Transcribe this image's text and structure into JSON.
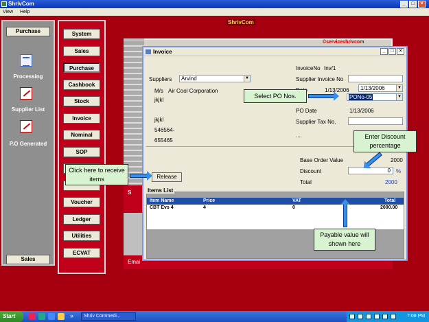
{
  "window": {
    "title": "ShrivCom",
    "buttons": [
      "_",
      "□",
      "×"
    ]
  },
  "menu": [
    "View",
    "Help"
  ],
  "brand": "ShrivCom",
  "sidebar": {
    "top_button": "Purchase",
    "items": [
      {
        "label": "Processing",
        "icon": "document-icon"
      },
      {
        "label": "Supplier List",
        "icon": "edit-icon"
      },
      {
        "label": "P.O Generated",
        "icon": "edit-icon"
      }
    ],
    "bottom_button": "Sales"
  },
  "modules": [
    "System",
    "Sales",
    "Purchase",
    "Cashbook",
    "Stock",
    "Invoice",
    "Nominal",
    "SOP",
    "",
    "",
    "Voucher",
    "Ledger",
    "Utilities",
    "ECVAT"
  ],
  "active_module": "Purchase",
  "background": {
    "logo": "©serviceshrivcom",
    "footer_text": "Emai",
    "red_bar_text": "S"
  },
  "invoice": {
    "title": "Invoice",
    "suppliers_label": "Suppliers",
    "suppliers_value": "Arvind",
    "ms_label": "M/s",
    "ms_value": "Air  Cool Corporation",
    "address": [
      "jkjkl",
      "jkjkl",
      "546564-",
      "655465"
    ],
    "invoice_no_label": "InvoiceNo",
    "invoice_no_value": "Inv/1",
    "supplier_invoice_no_label": "Supplier Invoice No",
    "date_label": "Date",
    "date_value": "1/13/2006",
    "date_picker_value": "1/13/2006",
    "po_nos_value": "PONo-05",
    "po_date_label": "PO Date",
    "po_date_value": "1/13/2006",
    "supplier_tax_label": "Supplier Tax No.",
    "ellipsis": "....",
    "base_order_label": "Base Order Value",
    "base_order_value": "2000",
    "discount_label": "Discount",
    "discount_value": "0",
    "discount_unit": "%",
    "total_label": "Total",
    "total_value": "2000",
    "release_button": "Release",
    "items_list_title": "Items List",
    "columns": [
      "Item Name",
      "Price",
      "VAT",
      "Total"
    ],
    "rows": [
      [
        "CBT Evs 4",
        "4",
        "0",
        "2000.00"
      ]
    ]
  },
  "callouts": {
    "select_po": "Select PO Nos.",
    "enter_discount": "Enter Discount percentage",
    "receive_items": "Click here to receive items",
    "payable_value": "Payable value will shown here"
  },
  "taskbar": {
    "start": "Start",
    "task": "Shriv Commedi...",
    "chevron": "»",
    "clock": "7:08 PM"
  },
  "colors": {
    "app_red": "#a60010",
    "module_red": "#c0001a",
    "callout_green": "#d8f3d0",
    "arrow_blue": "#3a8ee8",
    "header_blue": "#1e4ea8"
  }
}
